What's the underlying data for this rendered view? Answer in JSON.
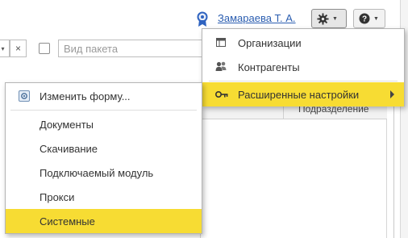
{
  "header": {
    "user_name": "Замараева Т. А."
  },
  "filter": {
    "package_placeholder": "Вид пакета",
    "clear_symbol": "×"
  },
  "table": {
    "column_label": "Подразделение"
  },
  "settings_menu": {
    "items": [
      {
        "label": "Организации",
        "icon": "table-icon"
      },
      {
        "label": "Контрагенты",
        "icon": "people-icon"
      },
      {
        "label": "Расширенные настройки",
        "icon": "key-icon",
        "submenu": true,
        "active": true
      }
    ]
  },
  "submenu": {
    "items": [
      {
        "label": "Изменить форму...",
        "icon": "form-icon"
      },
      {
        "label": "Документы"
      },
      {
        "label": "Скачивание"
      },
      {
        "label": "Подключаемый модуль"
      },
      {
        "label": "Прокси"
      },
      {
        "label": "Системные",
        "active": true
      }
    ]
  },
  "colors": {
    "highlight": "#f7dc33",
    "link": "#2a5db0"
  }
}
